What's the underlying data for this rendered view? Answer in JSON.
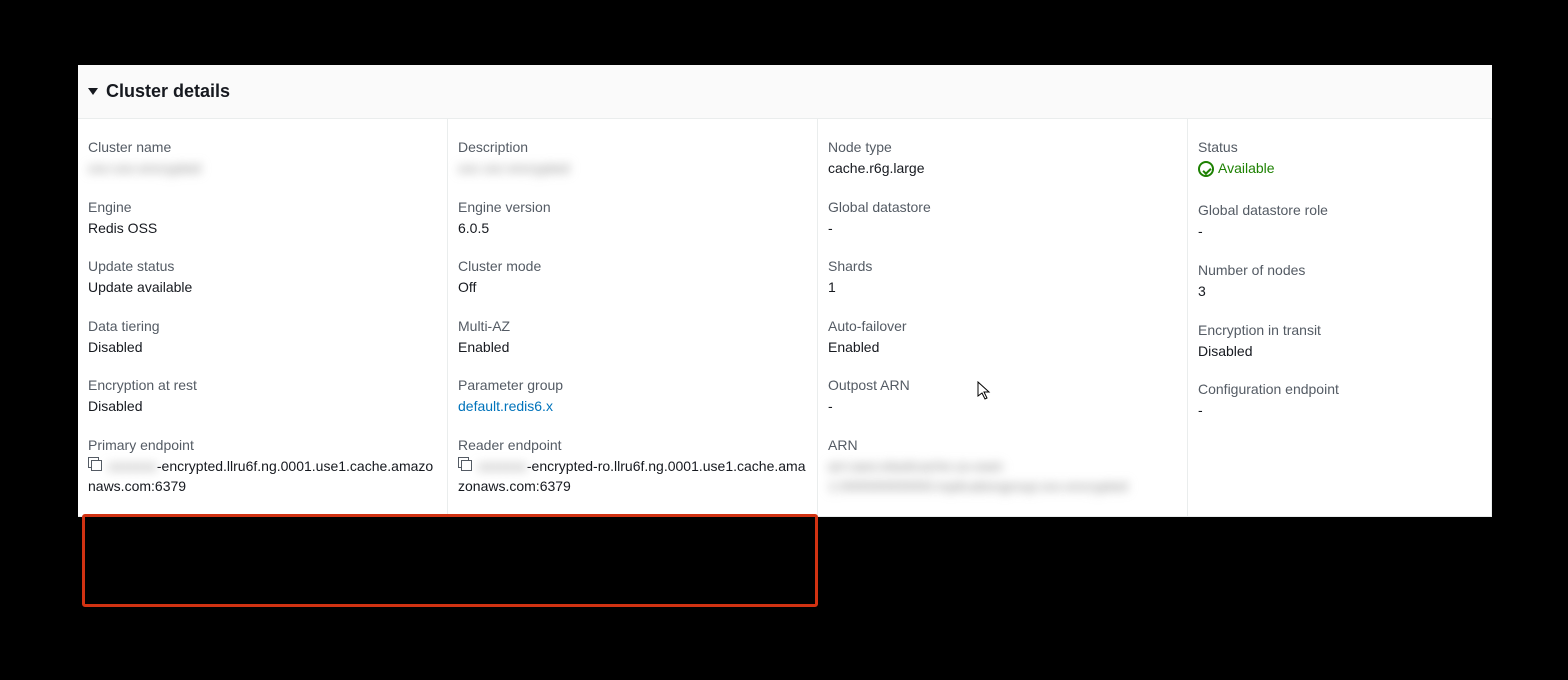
{
  "section_title": "Cluster details",
  "fields": {
    "cluster_name": {
      "label": "Cluster name",
      "value": "xxx-xxx-encrypted"
    },
    "description": {
      "label": "Description",
      "value": "xxx xxx encrypted"
    },
    "node_type": {
      "label": "Node type",
      "value": "cache.r6g.large"
    },
    "status": {
      "label": "Status",
      "value": "Available"
    },
    "engine": {
      "label": "Engine",
      "value": "Redis OSS"
    },
    "engine_version": {
      "label": "Engine version",
      "value": "6.0.5"
    },
    "global_datastore": {
      "label": "Global datastore",
      "value": "-"
    },
    "global_datastore_role": {
      "label": "Global datastore role",
      "value": "-"
    },
    "update_status": {
      "label": "Update status",
      "value": "Update available"
    },
    "cluster_mode": {
      "label": "Cluster mode",
      "value": "Off"
    },
    "shards": {
      "label": "Shards",
      "value": "1"
    },
    "number_of_nodes": {
      "label": "Number of nodes",
      "value": "3"
    },
    "data_tiering": {
      "label": "Data tiering",
      "value": "Disabled"
    },
    "multi_az": {
      "label": "Multi-AZ",
      "value": "Enabled"
    },
    "auto_failover": {
      "label": "Auto-failover",
      "value": "Enabled"
    },
    "encryption_in_transit": {
      "label": "Encryption in transit",
      "value": "Disabled"
    },
    "encryption_at_rest": {
      "label": "Encryption at rest",
      "value": "Disabled"
    },
    "parameter_group": {
      "label": "Parameter group",
      "value": "default.redis6.x"
    },
    "outpost_arn": {
      "label": "Outpost ARN",
      "value": "-"
    },
    "configuration_endpoint": {
      "label": "Configuration endpoint",
      "value": "-"
    },
    "primary_endpoint": {
      "label": "Primary endpoint",
      "redacted": "xxxxxxx",
      "value": "-encrypted.llru6f.ng.0001.use1.cache.amazonaws.com:6379"
    },
    "reader_endpoint": {
      "label": "Reader endpoint",
      "redacted": "xxxxxxx",
      "value": "-encrypted-ro.llru6f.ng.0001.use1.cache.amazonaws.com:6379"
    },
    "arn": {
      "label": "ARN",
      "value": "arn:aws:elasticache:us-east-1:000000000000:replicationgroup:xxx-encrypted"
    }
  }
}
